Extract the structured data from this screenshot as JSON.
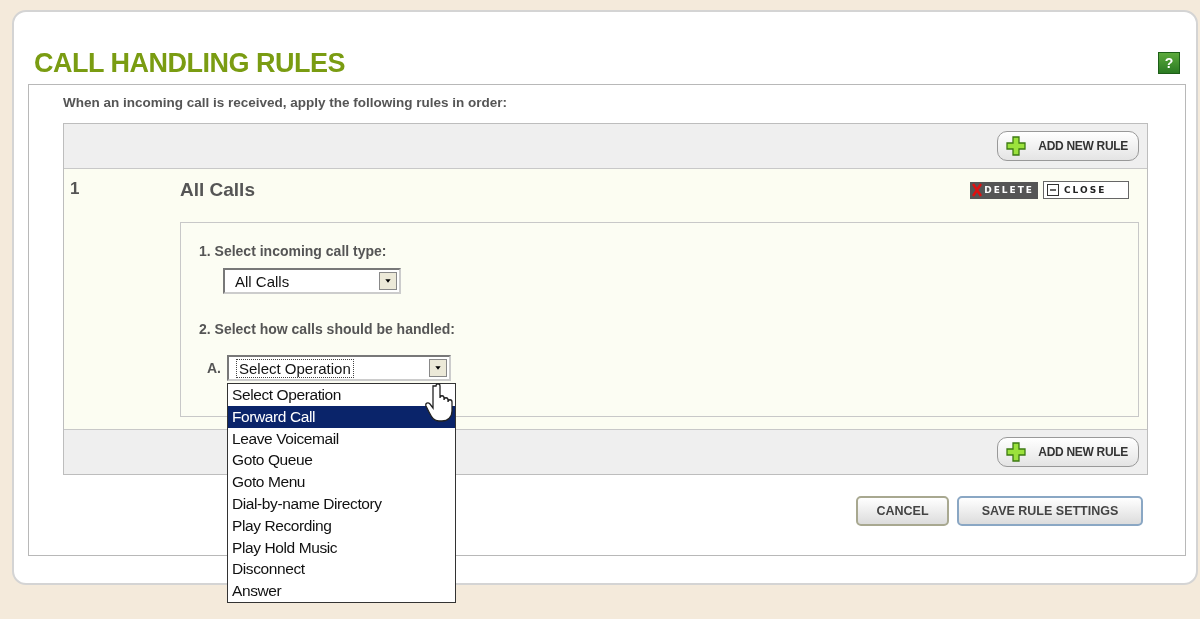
{
  "title": "CALL HANDLING RULES",
  "help": "?",
  "instruction": "When an incoming call is received, apply the following rules in order:",
  "header_button": "ADD NEW RULE",
  "rules": [
    {
      "number": "1",
      "name": "All Calls",
      "expanded": true,
      "delete_label": "DELETE",
      "close_label": "CLOSE",
      "call_type": {
        "label": "1. Select incoming call type:",
        "value": "All Calls"
      },
      "handling": {
        "label": "2. Select how calls should be handled:",
        "letter": "A.",
        "value": "Select Operation",
        "open": true,
        "options": [
          {
            "label": "Select Operation",
            "highlighted": false
          },
          {
            "label": "Forward Call",
            "highlighted": true
          },
          {
            "label": "Leave Voicemail",
            "highlighted": false
          },
          {
            "label": "Goto Queue",
            "highlighted": false
          },
          {
            "label": "Goto Menu",
            "highlighted": false
          },
          {
            "label": "Dial-by-name Directory",
            "highlighted": false
          },
          {
            "label": "Play Recording",
            "highlighted": false
          },
          {
            "label": "Play Hold Music",
            "highlighted": false
          },
          {
            "label": "Disconnect",
            "highlighted": false
          },
          {
            "label": "Answer",
            "highlighted": false
          }
        ]
      }
    }
  ],
  "footer_button": "ADD NEW RULE",
  "buttons": [
    {
      "label": "CANCEL",
      "kind": "cancel"
    },
    {
      "label": "SAVE RULE SETTINGS",
      "kind": "save"
    }
  ]
}
